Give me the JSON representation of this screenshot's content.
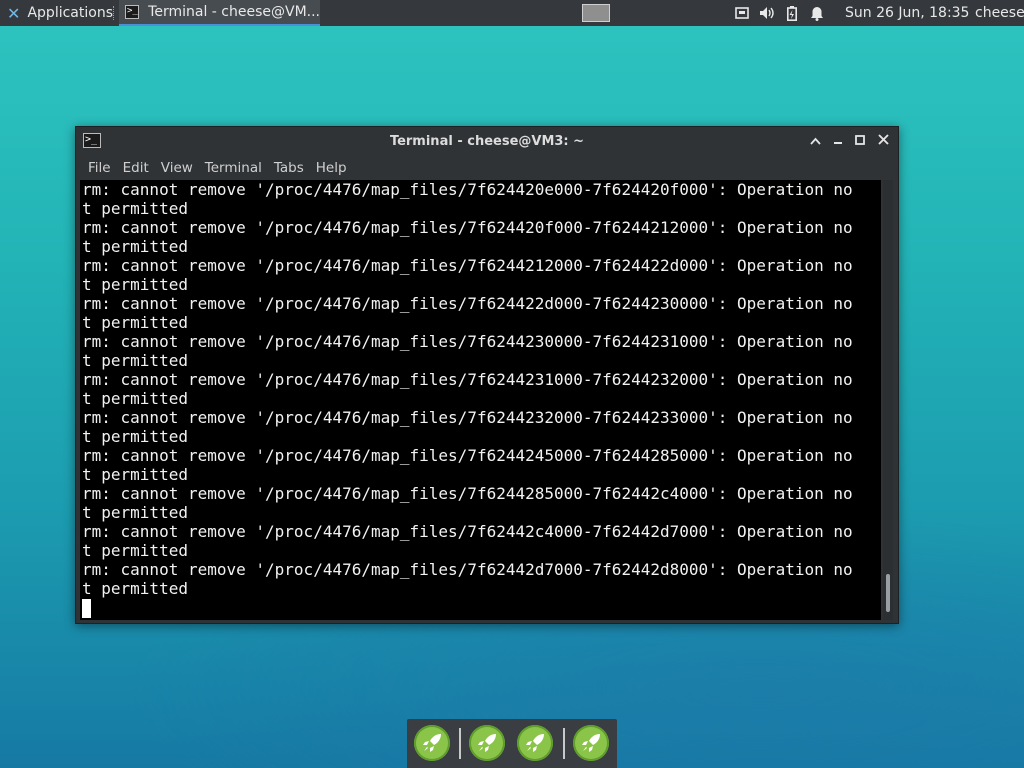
{
  "top_panel": {
    "applications_label": "Applications",
    "task_title": "Terminal - cheese@VM...",
    "clock": "Sun 26 Jun, 18:35",
    "user": "cheese"
  },
  "terminal": {
    "title": "Terminal - cheese@VM3: ~",
    "menu": [
      "File",
      "Edit",
      "View",
      "Terminal",
      "Tabs",
      "Help"
    ],
    "lines": [
      "rm: cannot remove '/proc/4476/map_files/7f624420e000-7f624420f000': Operation no",
      "t permitted",
      "rm: cannot remove '/proc/4476/map_files/7f624420f000-7f6244212000': Operation no",
      "t permitted",
      "rm: cannot remove '/proc/4476/map_files/7f6244212000-7f624422d000': Operation no",
      "t permitted",
      "rm: cannot remove '/proc/4476/map_files/7f624422d000-7f6244230000': Operation no",
      "t permitted",
      "rm: cannot remove '/proc/4476/map_files/7f6244230000-7f6244231000': Operation no",
      "t permitted",
      "rm: cannot remove '/proc/4476/map_files/7f6244231000-7f6244232000': Operation no",
      "t permitted",
      "rm: cannot remove '/proc/4476/map_files/7f6244232000-7f6244233000': Operation no",
      "t permitted",
      "rm: cannot remove '/proc/4476/map_files/7f6244245000-7f6244285000': Operation no",
      "t permitted",
      "rm: cannot remove '/proc/4476/map_files/7f6244285000-7f62442c4000': Operation no",
      "t permitted",
      "rm: cannot remove '/proc/4476/map_files/7f62442c4000-7f62442d7000': Operation no",
      "t permitted",
      "rm: cannot remove '/proc/4476/map_files/7f62442d7000-7f62442d8000': Operation no",
      "t permitted"
    ]
  },
  "icons": {
    "applications": "xfce-logo-icon",
    "terminal": "terminal-icon",
    "window_controls": [
      "maximize-up-icon",
      "minimize-icon",
      "maximize-icon",
      "close-icon"
    ],
    "tray": [
      "network-icon",
      "volume-icon",
      "battery-icon",
      "notification-bell-icon"
    ],
    "dock": "rocket-icon"
  },
  "colors": {
    "panel": "#35393d",
    "accent": "#4a90d9",
    "terminal_bg": "#000000",
    "terminal_fg": "#f2f2f2",
    "launcher": "#8ac54a"
  }
}
